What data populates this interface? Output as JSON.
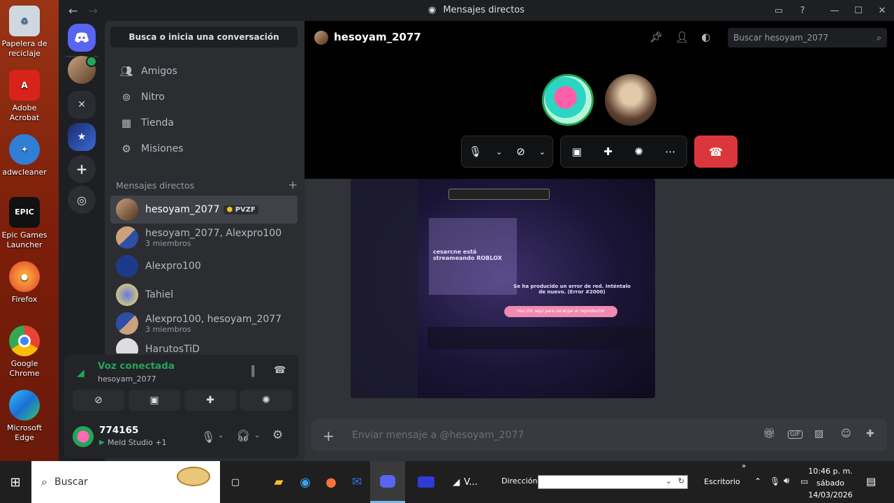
{
  "desktop": {
    "icons": [
      {
        "label": "Papelera de reciclaje"
      },
      {
        "label": "Adobe Acrobat"
      },
      {
        "label": "adwcleaner"
      },
      {
        "label": "Epic Games Launcher"
      },
      {
        "label": "Firefox"
      },
      {
        "label": "Google Chrome"
      },
      {
        "label": "Microsoft Edge"
      }
    ]
  },
  "window": {
    "title": "Mensajes directos"
  },
  "dm_sidebar": {
    "search_placeholder": "Busca o inicia una conversación",
    "nav": [
      {
        "label": "Amigos",
        "icon": "friends-icon"
      },
      {
        "label": "Nitro",
        "icon": "nitro-icon"
      },
      {
        "label": "Tienda",
        "icon": "shop-icon"
      },
      {
        "label": "Misiones",
        "icon": "quests-icon"
      }
    ],
    "section_title": "Mensajes directos",
    "add_symbol": "+",
    "dms": [
      {
        "name": "hesoyam_2077",
        "badge": "PVZF",
        "sub": ""
      },
      {
        "name": "hesoyam_2077, Alexpro100",
        "sub": "3 miembros"
      },
      {
        "name": "Alexpro100",
        "sub": ""
      },
      {
        "name": "Tahiel",
        "sub": ""
      },
      {
        "name": "Alexpro100, hesoyam_2077",
        "sub": "3 miembros"
      },
      {
        "name": "HarutosTiD",
        "sub": ""
      }
    ]
  },
  "voice_panel": {
    "status": "Voz conectada",
    "channel": "hesoyam_2077"
  },
  "user_panel": {
    "username": "774165",
    "activity": "Meld Studio +1"
  },
  "call": {
    "title": "hesoyam_2077",
    "search_placeholder": "Buscar hesoyam_2077"
  },
  "shared_screen": {
    "headline": "cesarcne está streameando ROBLOX",
    "error": "Se ha producido un error de red. Inténtalo de nuevo. (Error #2000)",
    "action": "Haz clic aquí para recargar el reproductor"
  },
  "composer": {
    "placeholder": "Enviar mensaje a @hesoyam_2077"
  },
  "taskbar": {
    "search_placeholder": "Buscar",
    "running_label": "V...",
    "address_label": "Dirección",
    "desktop_label": "Escritorio",
    "time": "10:46 p. m.",
    "day": "sábado",
    "date": "14/03/2026"
  },
  "colors": {
    "accent": "#5865f2",
    "voice_green": "#23a559",
    "danger": "#da373c",
    "background": "#313338"
  }
}
